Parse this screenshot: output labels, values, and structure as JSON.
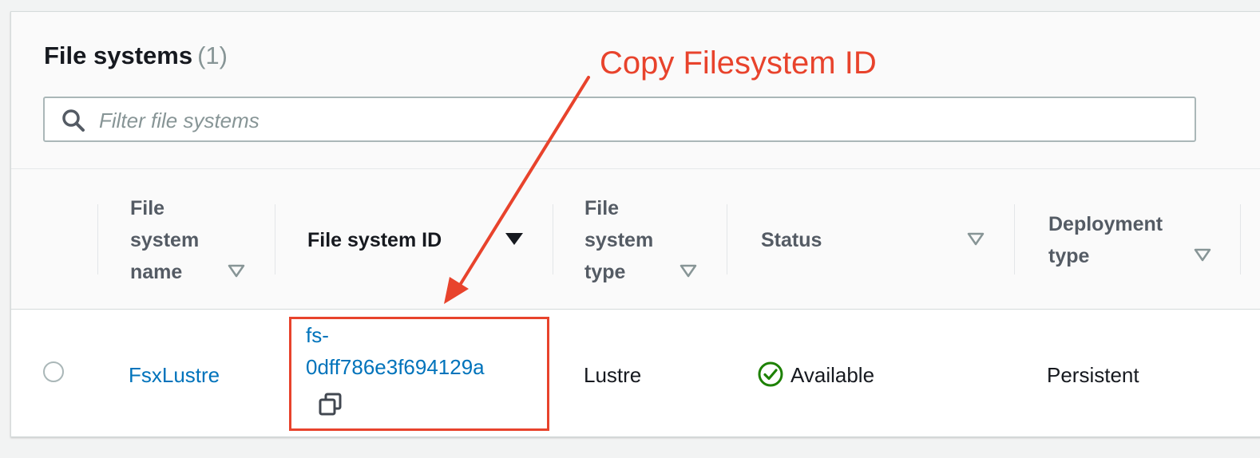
{
  "panel": {
    "title": "File systems",
    "count": "(1)"
  },
  "search": {
    "placeholder": "Filter file systems",
    "icon": "search-icon"
  },
  "table": {
    "columns": [
      {
        "label_lines": [
          "File",
          "system",
          "name"
        ],
        "sort": "unsorted"
      },
      {
        "label_lines": [
          "File system ID"
        ],
        "sort": "descending"
      },
      {
        "label_lines": [
          "File",
          "system",
          "type"
        ],
        "sort": "unsorted"
      },
      {
        "label_lines": [
          "Status"
        ],
        "sort": "unsorted"
      },
      {
        "label_lines": [
          "Deployment",
          "type"
        ],
        "sort": "unsorted"
      }
    ],
    "rows": [
      {
        "name": "FsxLustre",
        "id_lines": [
          "fs-",
          "0dff786e3f694129a"
        ],
        "type": "Lustre",
        "status": "Available",
        "deployment": "Persistent"
      }
    ]
  },
  "annotation": {
    "text": "Copy Filesystem ID",
    "color": "#e8432c"
  },
  "colors": {
    "link": "#0073bb",
    "success": "#1d8102",
    "annotation": "#e8432c"
  }
}
